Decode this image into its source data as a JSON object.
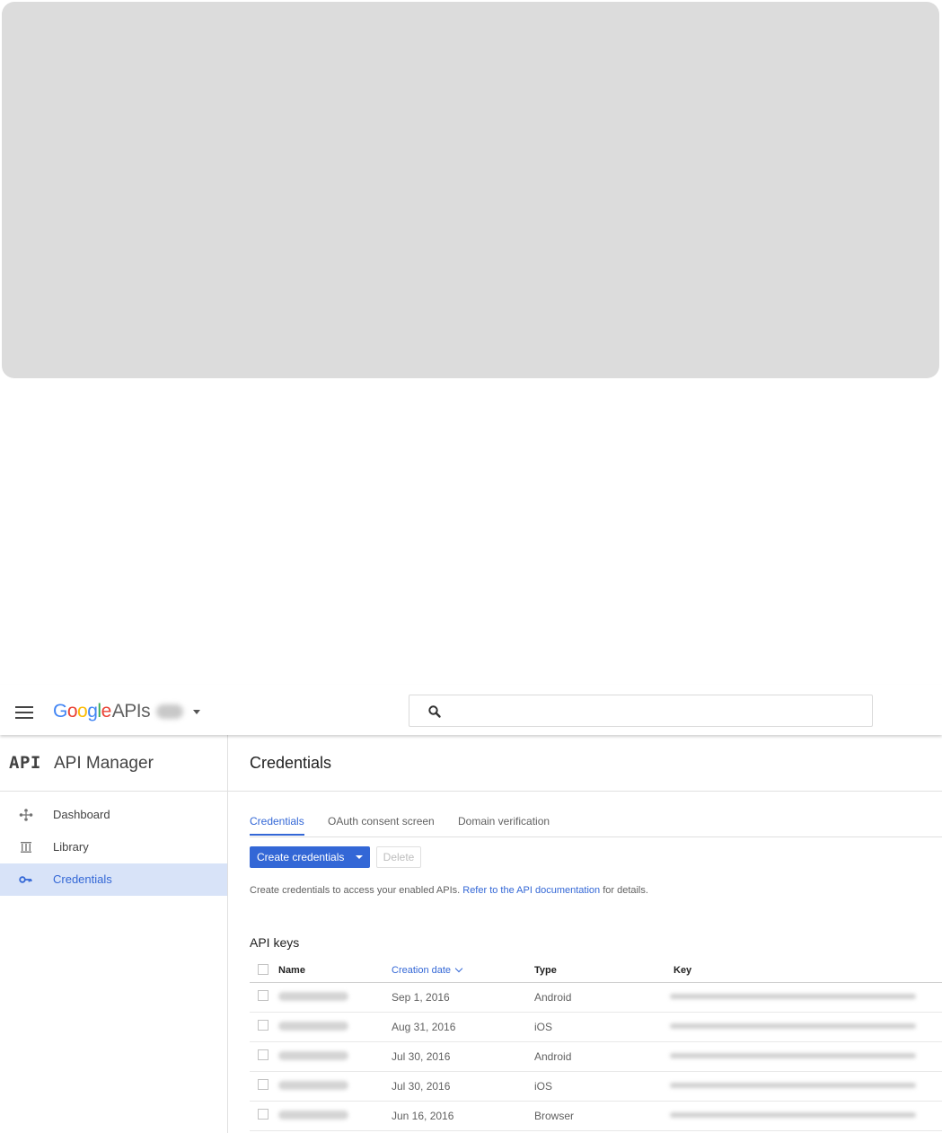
{
  "header": {
    "logo": {
      "letters": [
        "G",
        "o",
        "o",
        "g",
        "l",
        "e"
      ],
      "suffix": "APIs"
    },
    "search": {
      "placeholder": ""
    }
  },
  "sidebar": {
    "badge": "API",
    "title": "API Manager",
    "items": [
      {
        "label": "Dashboard",
        "icon": "dashboard-icon",
        "active": false
      },
      {
        "label": "Library",
        "icon": "library-icon",
        "active": false
      },
      {
        "label": "Credentials",
        "icon": "key-icon",
        "active": true
      }
    ]
  },
  "main": {
    "title": "Credentials",
    "tabs": [
      {
        "label": "Credentials",
        "active": true
      },
      {
        "label": "OAuth consent screen",
        "active": false
      },
      {
        "label": "Domain verification",
        "active": false
      }
    ],
    "create_button": "Create credentials",
    "delete_button": "Delete",
    "info": {
      "prefix": "Create credentials to access your enabled APIs.",
      "link": "Refer to the API documentation",
      "suffix": "for details."
    },
    "api_keys": {
      "title": "API keys",
      "columns": {
        "name": "Name",
        "creation_date": "Creation date",
        "type": "Type",
        "key": "Key"
      },
      "rows": [
        {
          "date": "Sep 1, 2016",
          "type": "Android"
        },
        {
          "date": "Aug 31, 2016",
          "type": "iOS"
        },
        {
          "date": "Jul 30, 2016",
          "type": "Android"
        },
        {
          "date": "Jul 30, 2016",
          "type": "iOS"
        },
        {
          "date": "Jun 16, 2016",
          "type": "Browser"
        }
      ]
    }
  },
  "colors": {
    "accent": "#3367d6",
    "active_nav_bg": "#d8e3f8",
    "placeholder_panel": "#dcdcdc"
  }
}
